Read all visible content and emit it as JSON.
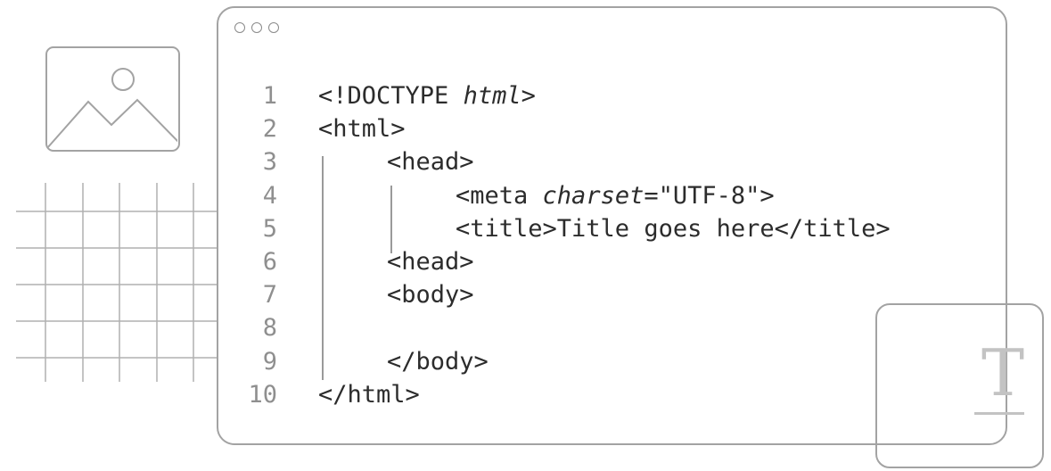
{
  "window": {
    "controls": [
      "dot-1",
      "dot-2",
      "dot-3"
    ]
  },
  "editor": {
    "lines": [
      {
        "num": "1",
        "segments": [
          {
            "text": "<!DOCTYPE "
          },
          {
            "text": "html",
            "italic": true
          },
          {
            "text": ">"
          }
        ],
        "indent": 0
      },
      {
        "num": "2",
        "segments": [
          {
            "text": "<html>"
          }
        ],
        "indent": 0
      },
      {
        "num": "3",
        "segments": [
          {
            "text": "<head>"
          }
        ],
        "indent": 1
      },
      {
        "num": "4",
        "segments": [
          {
            "text": "<meta "
          },
          {
            "text": "charset",
            "italic": true
          },
          {
            "text": "=\"UTF-8\">"
          }
        ],
        "indent": 2
      },
      {
        "num": "5",
        "segments": [
          {
            "text": "<title>Title goes here</title>"
          }
        ],
        "indent": 2
      },
      {
        "num": "6",
        "segments": [
          {
            "text": "<head>"
          }
        ],
        "indent": 1
      },
      {
        "num": "7",
        "segments": [
          {
            "text": "<body>"
          }
        ],
        "indent": 1
      },
      {
        "num": "8",
        "segments": [],
        "indent": 0
      },
      {
        "num": "9",
        "segments": [
          {
            "text": "</body>"
          }
        ],
        "indent": 1
      },
      {
        "num": "10",
        "segments": [
          {
            "text": "</html>"
          }
        ],
        "indent": 0
      }
    ]
  },
  "icons": {
    "image_card": "image-placeholder-icon",
    "type_card": "text-type-icon",
    "type_glyph": "T"
  },
  "colors": {
    "border": "#a3a3a3",
    "code_text": "#2c2c2c",
    "line_number": "#8f8f8f",
    "glyph": "#c3c3c3"
  }
}
